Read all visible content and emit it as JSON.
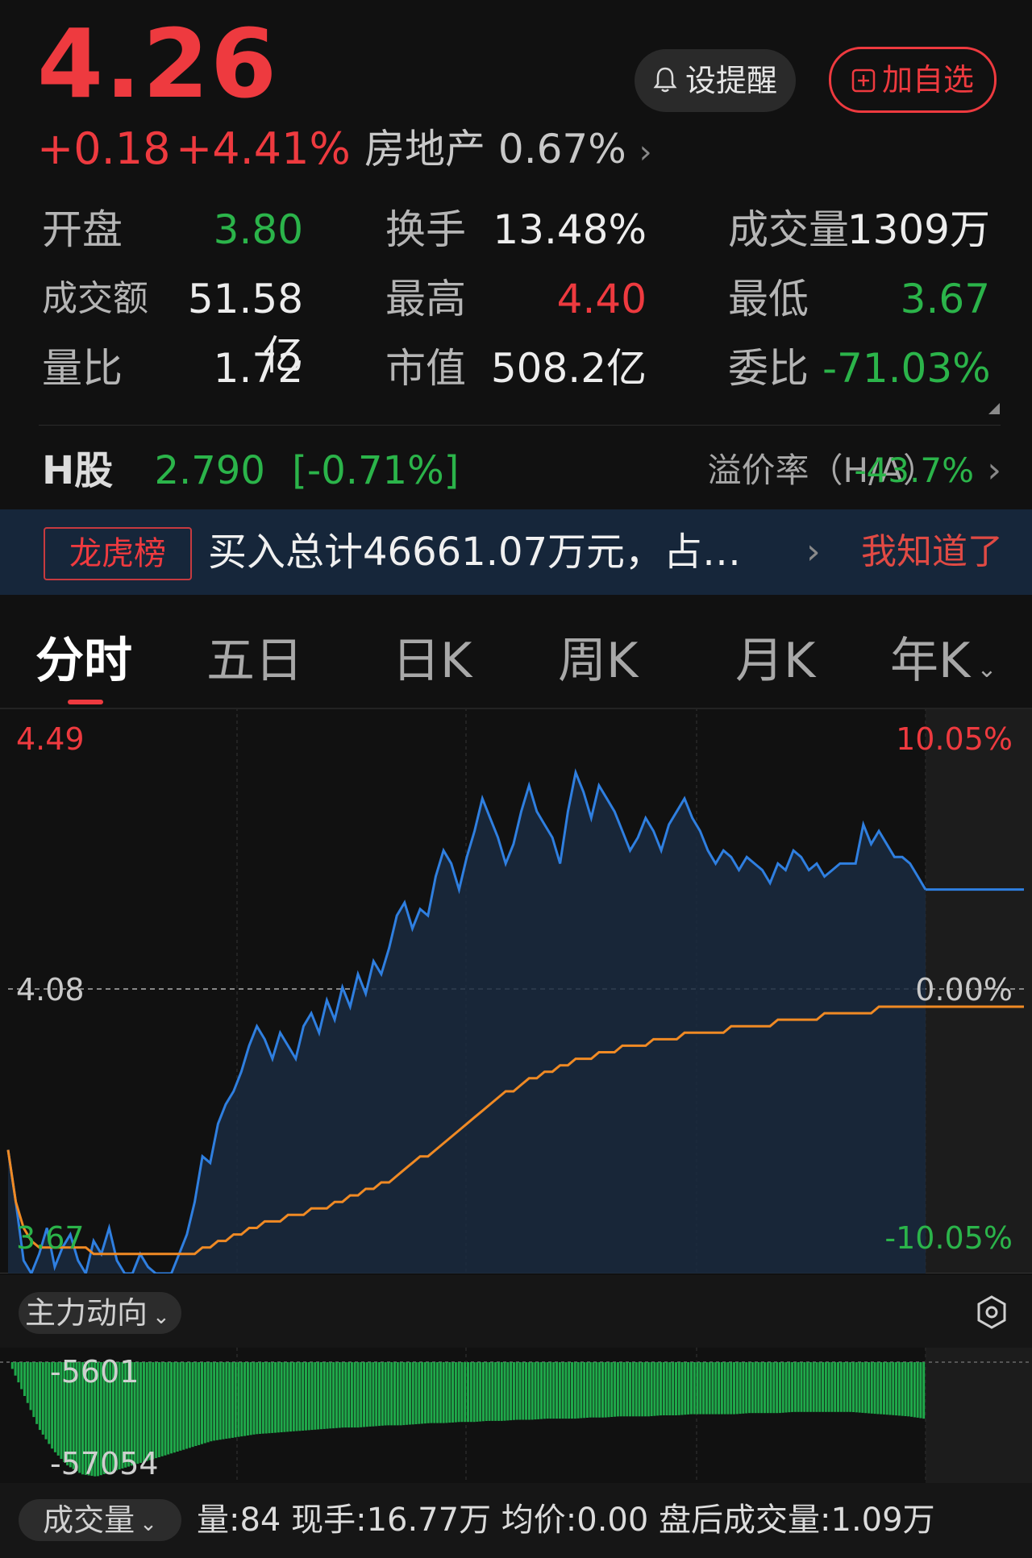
{
  "quote": {
    "price": "4.26",
    "change": "+0.18",
    "change_pct": "+4.41%",
    "sector_name": "房地产",
    "sector_pct": "0.67%"
  },
  "actions": {
    "remind_label": "设提醒",
    "add_watchlist_label": "加自选"
  },
  "stats": {
    "open_label": "开盘",
    "open_value": "3.80",
    "turnover_label": "换手",
    "turnover_value": "13.48%",
    "volume_label": "成交量",
    "volume_value": "1309万",
    "amount_label": "成交额",
    "amount_value": "51.58亿",
    "high_label": "最高",
    "high_value": "4.40",
    "low_label": "最低",
    "low_value": "3.67",
    "vol_ratio_label": "量比",
    "vol_ratio_value": "1.72",
    "mkt_cap_label": "市值",
    "mkt_cap_value": "508.2亿",
    "commission_label": "委比",
    "commission_value": "-71.03%"
  },
  "h_share": {
    "label": "H股",
    "price": "2.790",
    "change": "[-0.71%]",
    "premium_label": "溢价率（H/A）",
    "premium_value": "-43.7%"
  },
  "banner": {
    "tag": "龙虎榜",
    "text": "买入总计46661.07万元，占…",
    "dismiss": "我知道了"
  },
  "tabs": [
    "分时",
    "五日",
    "日K",
    "周K",
    "月K",
    "年K"
  ],
  "chart_labels": {
    "price_high": "4.49",
    "price_mid": "4.08",
    "price_low": "3.67",
    "pct_high": "10.05%",
    "pct_mid": "0.00%",
    "pct_low": "-10.05%"
  },
  "flow": {
    "label": "主力动向",
    "top_value": "-5601",
    "bottom_value": "-57054"
  },
  "volume_bar": {
    "label": "成交量",
    "info": "量:84  现手:16.77万  均价:0.00  盘后成交量:1.09万"
  },
  "colors": {
    "up": "#ee3a3f",
    "down": "#2bb44a",
    "price_line": "#2f7fe0",
    "avg_line": "#f08a24",
    "background": "#111111"
  },
  "chart_data": {
    "type": "line",
    "ylim": [
      3.67,
      4.49
    ],
    "series": [
      {
        "name": "price",
        "values": [
          3.86,
          3.78,
          3.69,
          3.67,
          3.7,
          3.74,
          3.68,
          3.71,
          3.73,
          3.69,
          3.67,
          3.72,
          3.7,
          3.74,
          3.69,
          3.67,
          3.67,
          3.7,
          3.68,
          3.67,
          3.67,
          3.67,
          3.7,
          3.73,
          3.78,
          3.85,
          3.84,
          3.9,
          3.93,
          3.95,
          3.98,
          4.02,
          4.05,
          4.03,
          4.0,
          4.04,
          4.02,
          4.0,
          4.05,
          4.07,
          4.04,
          4.09,
          4.06,
          4.11,
          4.08,
          4.13,
          4.1,
          4.15,
          4.13,
          4.17,
          4.22,
          4.24,
          4.2,
          4.23,
          4.22,
          4.28,
          4.32,
          4.3,
          4.26,
          4.31,
          4.35,
          4.4,
          4.37,
          4.34,
          4.3,
          4.33,
          4.38,
          4.42,
          4.38,
          4.36,
          4.34,
          4.3,
          4.38,
          4.44,
          4.41,
          4.37,
          4.42,
          4.4,
          4.38,
          4.35,
          4.32,
          4.34,
          4.37,
          4.35,
          4.32,
          4.36,
          4.38,
          4.4,
          4.37,
          4.35,
          4.32,
          4.3,
          4.32,
          4.31,
          4.29,
          4.31,
          4.3,
          4.29,
          4.27,
          4.3,
          4.29,
          4.32,
          4.31,
          4.29,
          4.3,
          4.28,
          4.29,
          4.3,
          4.3,
          4.3,
          4.36,
          4.33,
          4.35,
          4.33,
          4.31,
          4.31,
          4.3,
          4.28,
          4.26
        ]
      },
      {
        "name": "avg",
        "values": [
          3.86,
          3.78,
          3.74,
          3.72,
          3.71,
          3.71,
          3.71,
          3.71,
          3.71,
          3.71,
          3.71,
          3.7,
          3.7,
          3.7,
          3.7,
          3.7,
          3.7,
          3.7,
          3.7,
          3.7,
          3.7,
          3.7,
          3.7,
          3.7,
          3.7,
          3.71,
          3.71,
          3.72,
          3.72,
          3.73,
          3.73,
          3.74,
          3.74,
          3.75,
          3.75,
          3.75,
          3.76,
          3.76,
          3.76,
          3.77,
          3.77,
          3.77,
          3.78,
          3.78,
          3.79,
          3.79,
          3.8,
          3.8,
          3.81,
          3.81,
          3.82,
          3.83,
          3.84,
          3.85,
          3.85,
          3.86,
          3.87,
          3.88,
          3.89,
          3.9,
          3.91,
          3.92,
          3.93,
          3.94,
          3.95,
          3.95,
          3.96,
          3.97,
          3.97,
          3.98,
          3.98,
          3.99,
          3.99,
          4.0,
          4.0,
          4.0,
          4.01,
          4.01,
          4.01,
          4.02,
          4.02,
          4.02,
          4.02,
          4.03,
          4.03,
          4.03,
          4.03,
          4.04,
          4.04,
          4.04,
          4.04,
          4.04,
          4.04,
          4.05,
          4.05,
          4.05,
          4.05,
          4.05,
          4.05,
          4.06,
          4.06,
          4.06,
          4.06,
          4.06,
          4.06,
          4.07,
          4.07,
          4.07,
          4.07,
          4.07,
          4.07,
          4.07,
          4.08,
          4.08,
          4.08,
          4.08,
          4.08,
          4.08,
          4.08
        ]
      }
    ],
    "flow_values": [
      -5601,
      -20000,
      -35000,
      -45000,
      -52000,
      -56000,
      -57054,
      -55000,
      -53000,
      -51000,
      -49000,
      -47000,
      -45000,
      -43000,
      -41000,
      -40000,
      -39000,
      -38000,
      -37500,
      -37000,
      -36500,
      -36000,
      -35500,
      -35000,
      -35000,
      -34500,
      -34000,
      -34000,
      -33500,
      -33000,
      -33000,
      -32500,
      -32500,
      -32000,
      -32000,
      -31500,
      -31500,
      -31000,
      -31000,
      -31000,
      -30500,
      -30500,
      -30000,
      -30000,
      -30000,
      -29500,
      -29500,
      -29000,
      -29000,
      -29000,
      -29000,
      -28500,
      -28500,
      -28500,
      -28000,
      -28000,
      -28000,
      -28000,
      -28000,
      -28500,
      -29000,
      -29500,
      -30000,
      -31000
    ]
  }
}
